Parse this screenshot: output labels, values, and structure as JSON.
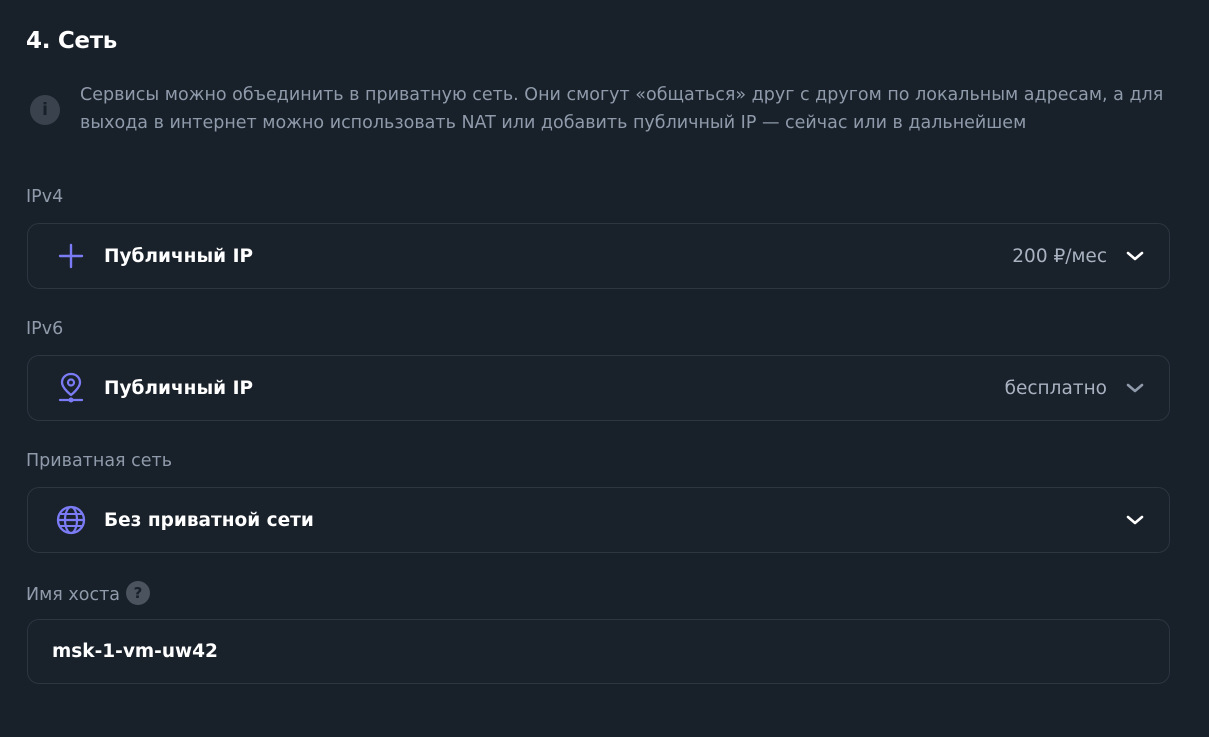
{
  "section": {
    "title": "4. Сеть",
    "info": "Сервисы можно объединить в приватную сеть. Они смогут «общаться» друг с другом по локальным адресам, а для выхода в интернет можно использовать NAT или добавить публичный IP — сейчас или в дальнейшем"
  },
  "ipv4": {
    "label": "IPv4",
    "option": "Публичный IP",
    "price": "200 ₽/мес",
    "icon": "plus-icon"
  },
  "ipv6": {
    "label": "IPv6",
    "option": "Публичный IP",
    "price": "бесплатно",
    "icon": "location-pin-icon"
  },
  "private_network": {
    "label": "Приватная сеть",
    "option": "Без приватной сети",
    "icon": "globe-icon"
  },
  "hostname": {
    "label": "Имя хоста",
    "value": "msk-1-vm-uw42"
  },
  "colors": {
    "background": "#18202a",
    "accent": "#7b7cf5",
    "muted_text": "#8f9aaa",
    "border": "#2c3540"
  }
}
